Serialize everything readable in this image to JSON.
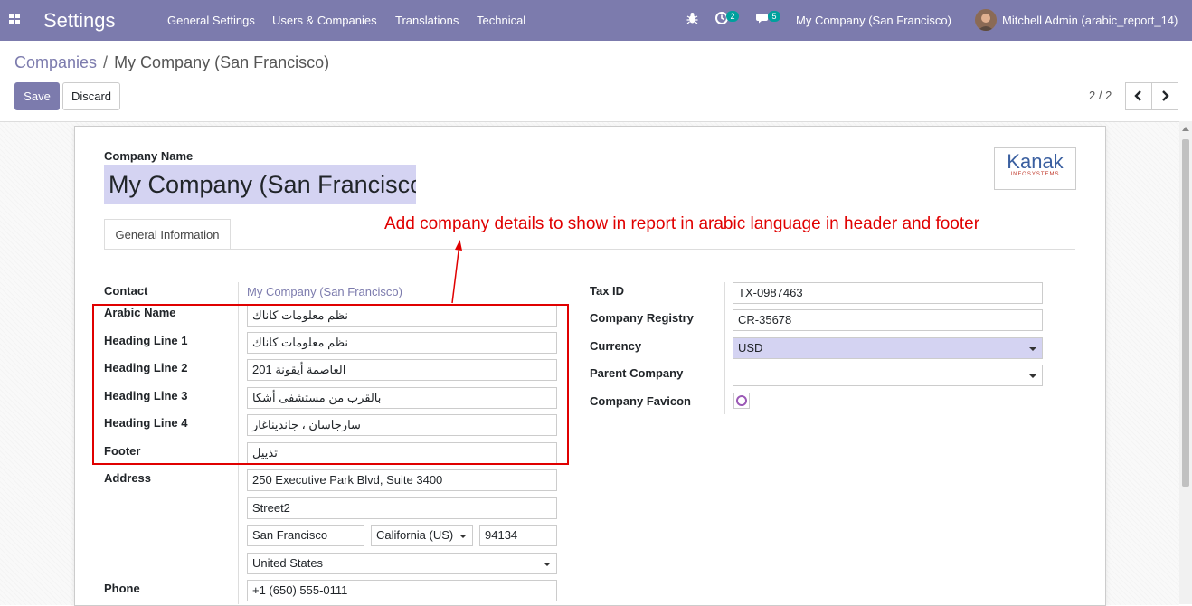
{
  "navbar": {
    "app_title": "Settings",
    "menu": [
      "General Settings",
      "Users & Companies",
      "Translations",
      "Technical"
    ],
    "activity_count": "2",
    "message_count": "5",
    "company": "My Company (San Francisco)",
    "user": "Mitchell Admin (arabic_report_14)",
    "brand_color": "#7c7bad"
  },
  "breadcrumb": {
    "parent": "Companies",
    "separator": "/",
    "current": "My Company (San Francisco)"
  },
  "toolbar": {
    "save_label": "Save",
    "discard_label": "Discard",
    "pager": "2 / 2"
  },
  "form": {
    "company_name_label": "Company Name",
    "company_name": "My Company (San Francisco",
    "logo": {
      "title": "Kanak",
      "subtitle": "INFOSYSTEMS"
    },
    "tab": "General Information",
    "annotation": "Add company details to show in report in arabic language in header and footer",
    "left": {
      "contact_label": "Contact",
      "contact_value": "My Company (San Francisco)",
      "arabic_name_label": "Arabic Name",
      "arabic_name": "نظم معلومات كاناك",
      "heading1_label": "Heading Line 1",
      "heading1": "نظم معلومات كاناك",
      "heading2_label": "Heading Line 2",
      "heading2": "العاصمة أيقونة 201",
      "heading3_label": "Heading Line 3",
      "heading3": "بالقرب من مستشفى أشكا",
      "heading4_label": "Heading Line 4",
      "heading4": "سارجاسان ، جانديناغار",
      "footer_label": "Footer",
      "footer": "تذييل",
      "address_label": "Address",
      "street": "250 Executive Park Blvd, Suite 3400",
      "street2_placeholder": "Street2",
      "city": "San Francisco",
      "state": "California (US)",
      "zip": "94134",
      "country": "United States",
      "phone_label": "Phone",
      "phone": "+1 (650) 555-0111"
    },
    "right": {
      "tax_id_label": "Tax ID",
      "tax_id": "TX-0987463",
      "registry_label": "Company Registry",
      "registry": "CR-35678",
      "currency_label": "Currency",
      "currency": "USD",
      "parent_label": "Parent Company",
      "parent": "",
      "favicon_label": "Company Favicon"
    }
  }
}
